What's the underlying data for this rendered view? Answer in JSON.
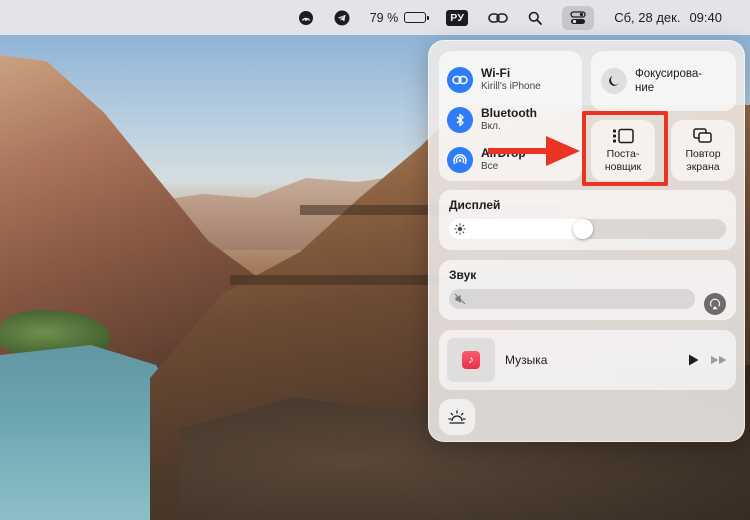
{
  "menubar": {
    "battery_percent": "79 %",
    "battery_level": 0.79,
    "input_language": "РУ",
    "date": "Сб, 28 дек.",
    "time": "09:40",
    "icons": [
      "cast-icon",
      "telegram-icon",
      "battery-icon",
      "input-source-icon",
      "link-icon",
      "search-icon",
      "control-center-icon"
    ]
  },
  "control_center": {
    "network": [
      {
        "title": "Wi-Fi",
        "subtitle": "Kirill's iPhone",
        "icon": "wifi-icon"
      },
      {
        "title": "Bluetooth",
        "subtitle": "Вкл.",
        "icon": "bluetooth-icon"
      },
      {
        "title": "AirDrop",
        "subtitle": "Все",
        "icon": "airdrop-icon"
      }
    ],
    "focus": {
      "label": "Фокусирова-\nние",
      "icon": "moon-icon"
    },
    "stage_manager": {
      "label": "Поста-\nновщик",
      "icon": "stage-manager-icon"
    },
    "screen_mirroring": {
      "label": "Повтор\nэкрана",
      "icon": "screen-mirroring-icon"
    },
    "display": {
      "title": "Дисплей",
      "brightness": 0.52
    },
    "sound": {
      "title": "Звук",
      "volume": 0.0
    },
    "music": {
      "title": "Музыка"
    },
    "keyboard_brightness": {
      "icon": "keyboard-brightness-icon"
    }
  },
  "annotation": {
    "highlight_color": "#ea3323"
  },
  "colors": {
    "accent": "#2f7cf6"
  }
}
